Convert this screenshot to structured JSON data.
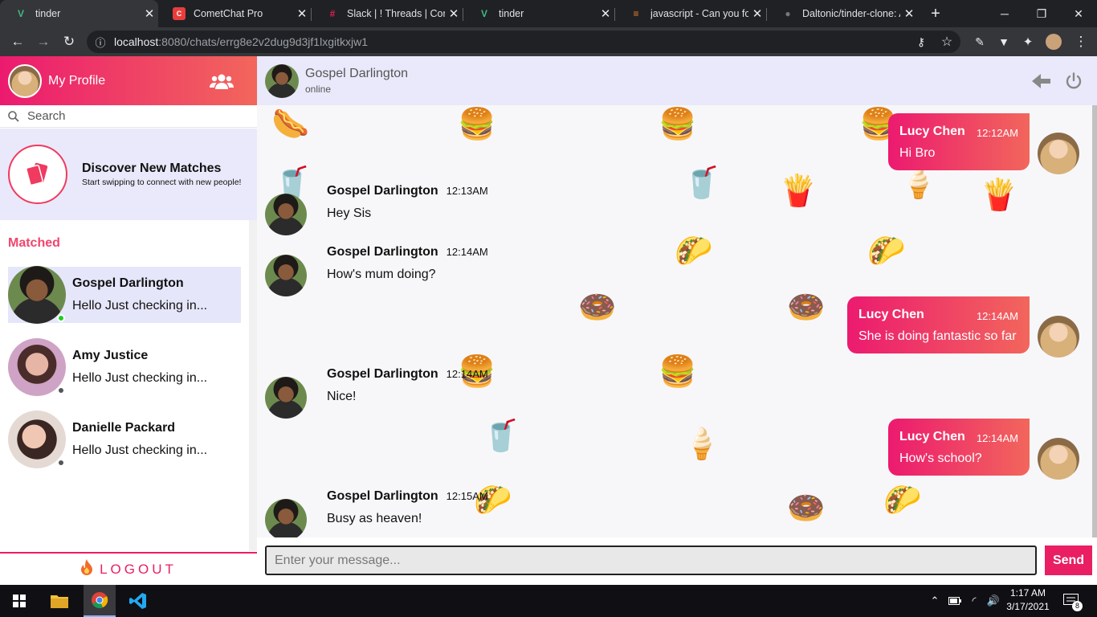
{
  "browser": {
    "tabs": [
      {
        "title": "tinder",
        "icon": "vue-logo-icon",
        "active": true
      },
      {
        "title": "CometChat Pro",
        "icon": "cometchat-logo-icon"
      },
      {
        "title": "Slack | ! Threads | Come",
        "icon": "slack-logo-icon"
      },
      {
        "title": "tinder",
        "icon": "vue-logo-icon"
      },
      {
        "title": "javascript - Can you for",
        "icon": "stackoverflow-logo-icon"
      },
      {
        "title": "Daltonic/tinder-clone: A",
        "icon": "github-logo-icon"
      }
    ],
    "new_tab": "+",
    "url_host": "localhost",
    "url_rest": ":8080/chats/errg8e2v2dug9d3jf1lxgitkxjw1"
  },
  "sidebar": {
    "profile_title": "My Profile",
    "search_placeholder": "Search",
    "discover_title": "Discover New Matches",
    "discover_subtitle": "Start swipping to connect with new people!",
    "matched_label": "Matched",
    "matches": [
      {
        "name": "Gospel Darlington",
        "preview": "Hello Just checking in...",
        "status": "online",
        "selected": true
      },
      {
        "name": "Amy Justice",
        "preview": "Hello Just checking in...",
        "status": "offline"
      },
      {
        "name": "Danielle Packard",
        "preview": "Hello Just checking in...",
        "status": "offline"
      }
    ],
    "logout_label": "LOGOUT"
  },
  "chat": {
    "contact_name": "Gospel Darlington",
    "contact_status": "online",
    "messages": [
      {
        "side": "right",
        "sender": "Lucy Chen",
        "time": "12:12AM",
        "text": "Hi Bro"
      },
      {
        "side": "left",
        "sender": "Gospel Darlington",
        "time": "12:13AM",
        "text": "Hey Sis"
      },
      {
        "side": "left",
        "sender": "Gospel Darlington",
        "time": "12:14AM",
        "text": "How's mum doing?"
      },
      {
        "side": "right",
        "sender": "Lucy Chen",
        "time": "12:14AM",
        "text": "She is doing fantastic so far"
      },
      {
        "side": "left",
        "sender": "Gospel Darlington",
        "time": "12:14AM",
        "text": "Nice!"
      },
      {
        "side": "right",
        "sender": "Lucy Chen",
        "time": "12:14AM",
        "text": "How's school?"
      },
      {
        "side": "left",
        "sender": "Gospel Darlington",
        "time": "12:15AM",
        "text": "Busy as heaven!"
      }
    ],
    "input_placeholder": "Enter your message...",
    "send_label": "Send"
  },
  "taskbar": {
    "time": "1:17 AM",
    "date": "3/17/2021",
    "notifications": "8"
  },
  "colors": {
    "accent_start": "#ec1a6f",
    "accent_end": "#f2665c",
    "highlight": "#e6e6fb",
    "online": "#22cc22",
    "offline": "#555555"
  }
}
